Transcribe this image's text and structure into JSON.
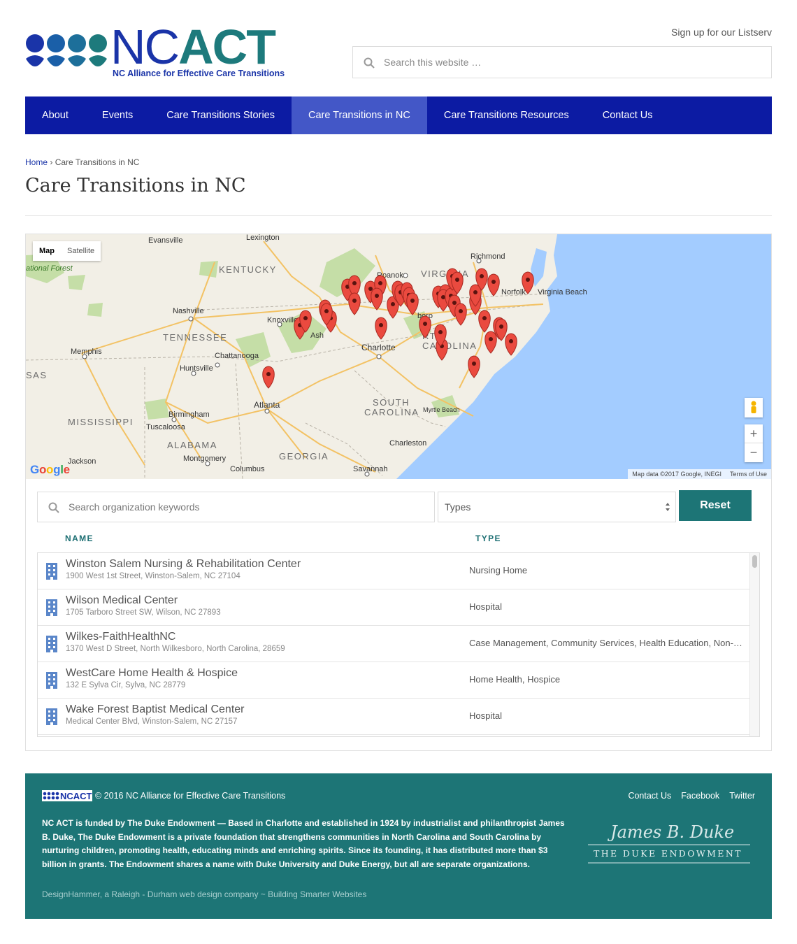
{
  "brand": {
    "nc": "NC",
    "act": "ACT",
    "tagline": "NC Alliance for Effective Care Transitions",
    "colors": {
      "blue": "#1a34a8",
      "teal": "#1d7a7c",
      "nav": "#0c1ba3",
      "nav_active": "#4357c7",
      "footer": "#1d7576"
    }
  },
  "header": {
    "listserv_label": "Sign up for our Listserv",
    "search_placeholder": "Search this website …"
  },
  "nav": {
    "items": [
      {
        "label": "About"
      },
      {
        "label": "Events"
      },
      {
        "label": "Care Transitions Stories"
      },
      {
        "label": "Care Transitions in NC",
        "active": true
      },
      {
        "label": "Care Transitions Resources"
      },
      {
        "label": "Contact Us"
      }
    ]
  },
  "breadcrumb": {
    "home": "Home",
    "sep": "›",
    "current": "Care Transitions in NC"
  },
  "page_title": "Care Transitions in NC",
  "map": {
    "type_map": "Map",
    "type_satellite": "Satellite",
    "google": "Google",
    "attribution": "Map data ©2017 Google, INEGI",
    "terms": "Terms of Use",
    "zoom_in": "+",
    "zoom_out": "−",
    "labels": {
      "evansville": "Evansville",
      "lexington": "Lexington",
      "national_forest": "ational Forest",
      "kentucky": "KENTUCKY",
      "richmond": "Richmond",
      "roanoke": "Roanoke",
      "virginia": "VIRGINIA",
      "norfolk": "Norfolk",
      "virginia_beach": "Virginia Beach",
      "nashville": "Nashville",
      "knoxville": "Knoxville",
      "tennessee": "TENNESSEE",
      "asheville": "Ash",
      "charlotte": "Charlotte",
      "north_carolina_1": "RTH",
      "north_carolina_2": "CAROLINA",
      "memphis": "Memphis",
      "chattanooga": "Chattanooga",
      "huntsville": "Huntsville",
      "sas": "SAS",
      "atlanta": "Atlanta",
      "birmingham": "Birmingham",
      "mississippi": "MISSISSIPPI",
      "tuscaloosa": "Tuscaloosa",
      "south": "SOUTH",
      "carolina": "CAROLINA",
      "myrtle_beach": "Myrtle Beach",
      "alabama": "ALABAMA",
      "charleston": "Charleston",
      "jackson": "Jackson",
      "montgomery": "Montgomery",
      "georgia": "GEORGIA",
      "columbus": "Columbus",
      "savannah": "Savannah",
      "raleigh_partial": "boro"
    }
  },
  "filters": {
    "search_placeholder": "Search organization keywords",
    "types_label": "Types",
    "reset_label": "Reset"
  },
  "table": {
    "col_name": "NAME",
    "col_type": "TYPE",
    "rows": [
      {
        "name": "Winston Salem Nursing & Rehabilitation Center",
        "address": "1900 West 1st Street, Winston-Salem, NC 27104",
        "type": "Nursing Home"
      },
      {
        "name": "Wilson Medical Center",
        "address": "1705 Tarboro Street SW, Wilson, NC 27893",
        "type": "Hospital"
      },
      {
        "name": "Wilkes-FaithHealthNC",
        "address": "1370 West D Street, North Wilkesboro, North Carolina, 28659",
        "type": "Case Management, Community Services, Health Education, Non-P…"
      },
      {
        "name": "WestCare Home Health & Hospice",
        "address": "132 E Sylva Cir, Sylva, NC 28779",
        "type": "Home Health, Hospice"
      },
      {
        "name": "Wake Forest Baptist Medical Center",
        "address": "Medical Center Blvd, Winston-Salem, NC 27157",
        "type": "Hospital"
      }
    ]
  },
  "footer": {
    "logo_text": "NCACT",
    "copyright": "© 2016 NC Alliance for Effective Care Transitions",
    "links": [
      "Contact Us",
      "Facebook",
      "Twitter"
    ],
    "funding_text": "NC ACT is funded by The Duke Endowment — Based in Charlotte and established in 1924 by industrialist and philanthropist James B. Duke, The Duke Endowment is a private foundation that strengthens communities in North Carolina and South Carolina by nurturing children, promoting health, educating minds and enriching spirits. Since its founding, it has distributed more than $3 billion in grants. The Endowment shares a name with Duke University and Duke Energy, but all are separate organizations.",
    "credit": "DesignHammer, a Raleigh - Durham web design company ~ Building Smarter Websites",
    "duke_signature": "James B. Duke",
    "duke_name": "THE DUKE ENDOWMENT"
  }
}
